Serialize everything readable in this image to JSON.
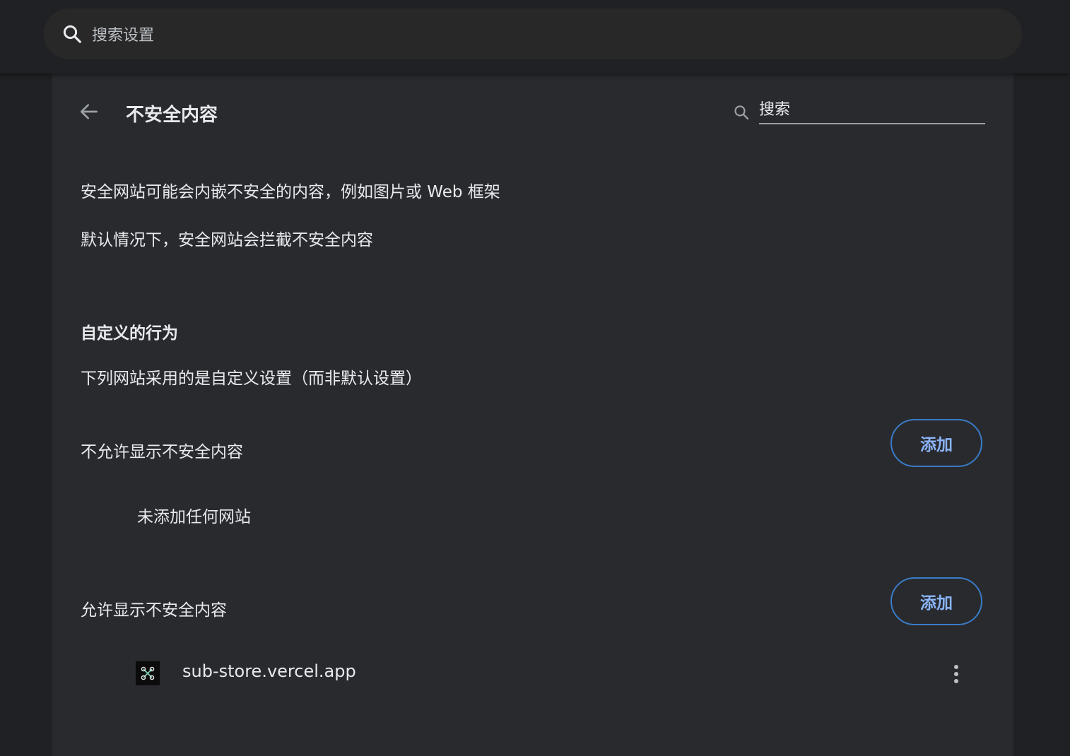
{
  "top_search": {
    "placeholder": "搜索设置",
    "icon": "search-icon"
  },
  "header": {
    "back_icon": "arrow-left-icon",
    "title": "不安全内容",
    "search_placeholder": "搜索",
    "search_icon": "search-icon"
  },
  "descriptions": {
    "line1": "安全网站可能会内嵌不安全的内容，例如图片或 Web 框架",
    "line2": "默认情况下，安全网站会拦截不安全内容"
  },
  "custom_behavior": {
    "heading": "自定义的行为",
    "subtitle": "下列网站采用的是自定义设置（而非默认设置）"
  },
  "block_section": {
    "label": "不允许显示不安全内容",
    "add_label": "添加",
    "empty_text": "未添加任何网站"
  },
  "allow_section": {
    "label": "允许显示不安全内容",
    "add_label": "添加",
    "sites": [
      {
        "url": "sub-store.vercel.app",
        "favicon": "sub-store-favicon",
        "more_icon": "more-vert-icon"
      }
    ]
  },
  "colors": {
    "page_bg": "#202124",
    "panel_bg": "#292a2d",
    "accent_text": "#8ab4f8",
    "button_border": "#3a7bc8"
  }
}
